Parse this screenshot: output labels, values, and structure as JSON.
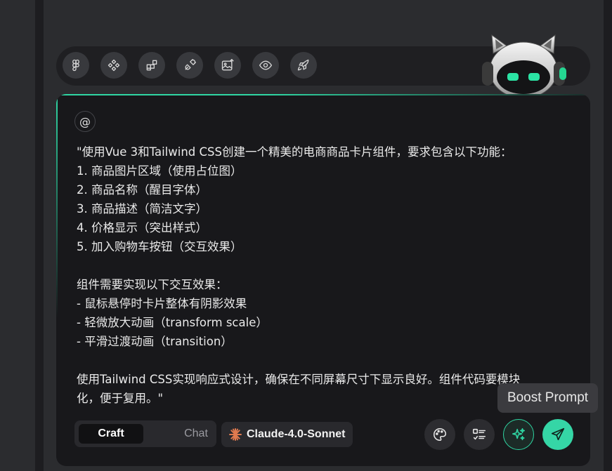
{
  "toolbar": {
    "tools": [
      {
        "icon": "figma-icon"
      },
      {
        "icon": "components-icon"
      },
      {
        "icon": "blocks-icon"
      },
      {
        "icon": "plug-icon"
      },
      {
        "icon": "image-upload-icon"
      },
      {
        "icon": "eye-icon"
      },
      {
        "icon": "rocket-icon"
      }
    ]
  },
  "composer": {
    "mention_symbol": "@",
    "prompt": "\"使用Vue 3和Tailwind CSS创建一个精美的电商商品卡片组件，要求包含以下功能：\n1. 商品图片区域（使用占位图）\n2. 商品名称（醒目字体）\n3. 商品描述（简洁文字）\n4. 价格显示（突出样式）\n5. 加入购物车按钮（交互效果）\n\n组件需要实现以下交互效果：\n- 鼠标悬停时卡片整体有阴影效果\n- 轻微放大动画（transform scale）\n- 平滑过渡动画（transition）\n\n使用Tailwind CSS实现响应式设计，确保在不同屏幕尺寸下显示良好。组件代码要模块\n化，便于复用。\""
  },
  "footer": {
    "modes": [
      "Craft",
      "Chat"
    ],
    "active_mode": "Craft",
    "model_label": "Claude-4.0-Sonnet",
    "boost_tooltip": "Boost Prompt"
  },
  "colors": {
    "accent": "#2fd6a3",
    "panel": "#18181b",
    "background": "#2b2c2f"
  }
}
